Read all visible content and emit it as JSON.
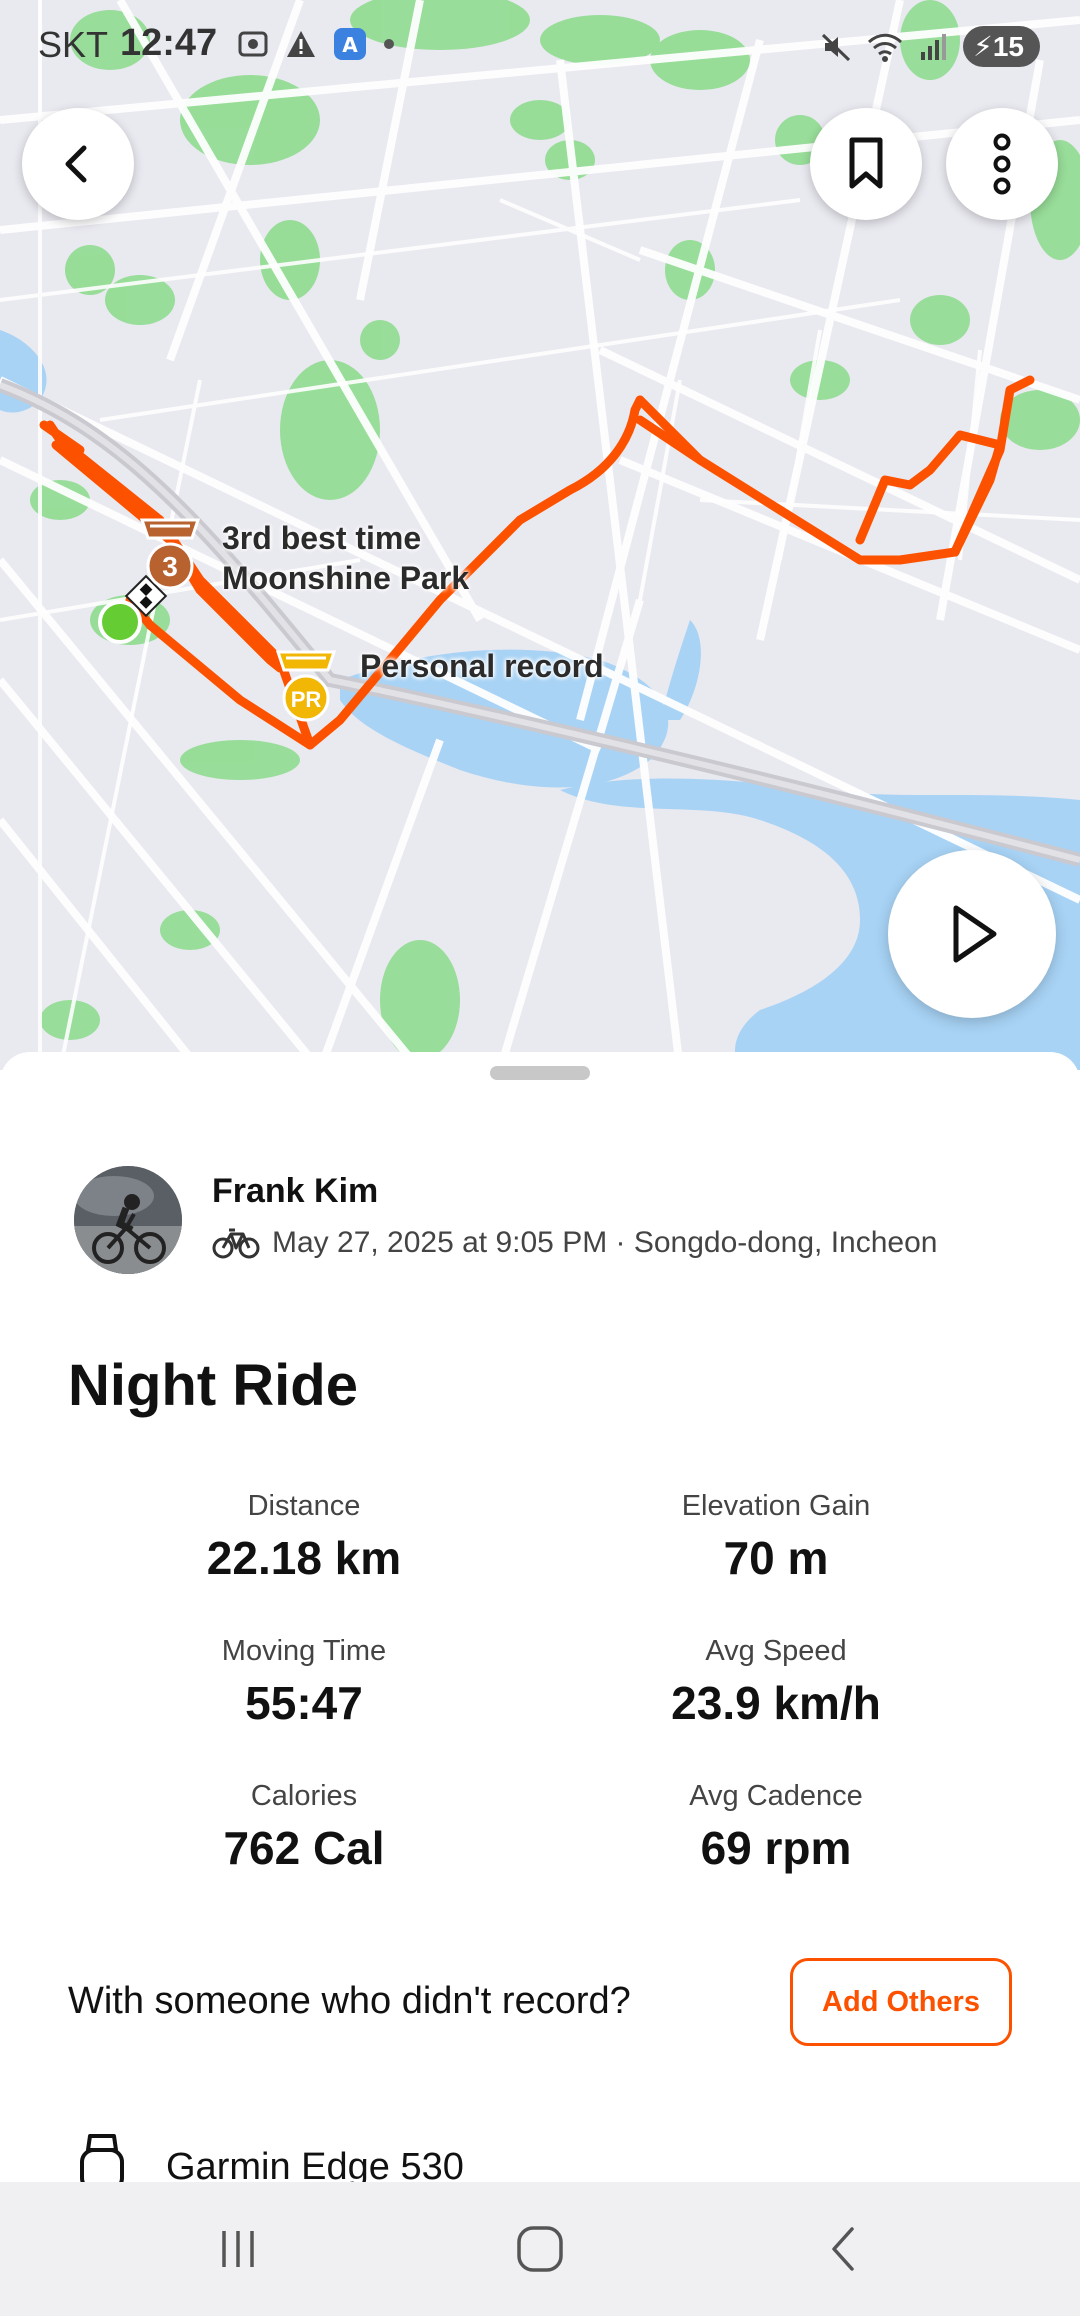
{
  "status_bar": {
    "carrier": "SKT",
    "time": "12:47",
    "battery": "15"
  },
  "map": {
    "badge_third_label": "3",
    "badge_pr_label": "PR",
    "segment_label_line1": "3rd best time",
    "segment_label_line2": "Moonshine Park",
    "pr_label": "Personal record",
    "colors": {
      "route": "#fc5200",
      "water": "#a8d3f5",
      "park": "#8fdc8f",
      "roads": "#ffffff",
      "land": "#e9e9f0"
    }
  },
  "athlete": {
    "name": "Frank Kim",
    "meta": "May 27, 2025 at 9:05 PM · Songdo-dong, Incheon"
  },
  "activity": {
    "title": "Night Ride",
    "stats": [
      {
        "label": "Distance",
        "value": "22.18 km"
      },
      {
        "label": "Elevation Gain",
        "value": "70 m"
      },
      {
        "label": "Moving Time",
        "value": "55:47"
      },
      {
        "label": "Avg Speed",
        "value": "23.9 km/h"
      },
      {
        "label": "Calories",
        "value": "762 Cal"
      },
      {
        "label": "Avg Cadence",
        "value": "69 rpm"
      }
    ]
  },
  "others": {
    "prompt": "With someone who didn't record?",
    "button": "Add Others"
  },
  "device": {
    "name": "Garmin Edge 530"
  },
  "icons": {
    "back": "back-arrow-icon",
    "bookmark": "bookmark-icon",
    "more": "more-vertical-icon",
    "play": "play-icon",
    "bike": "bike-icon",
    "watch": "watch-icon"
  }
}
